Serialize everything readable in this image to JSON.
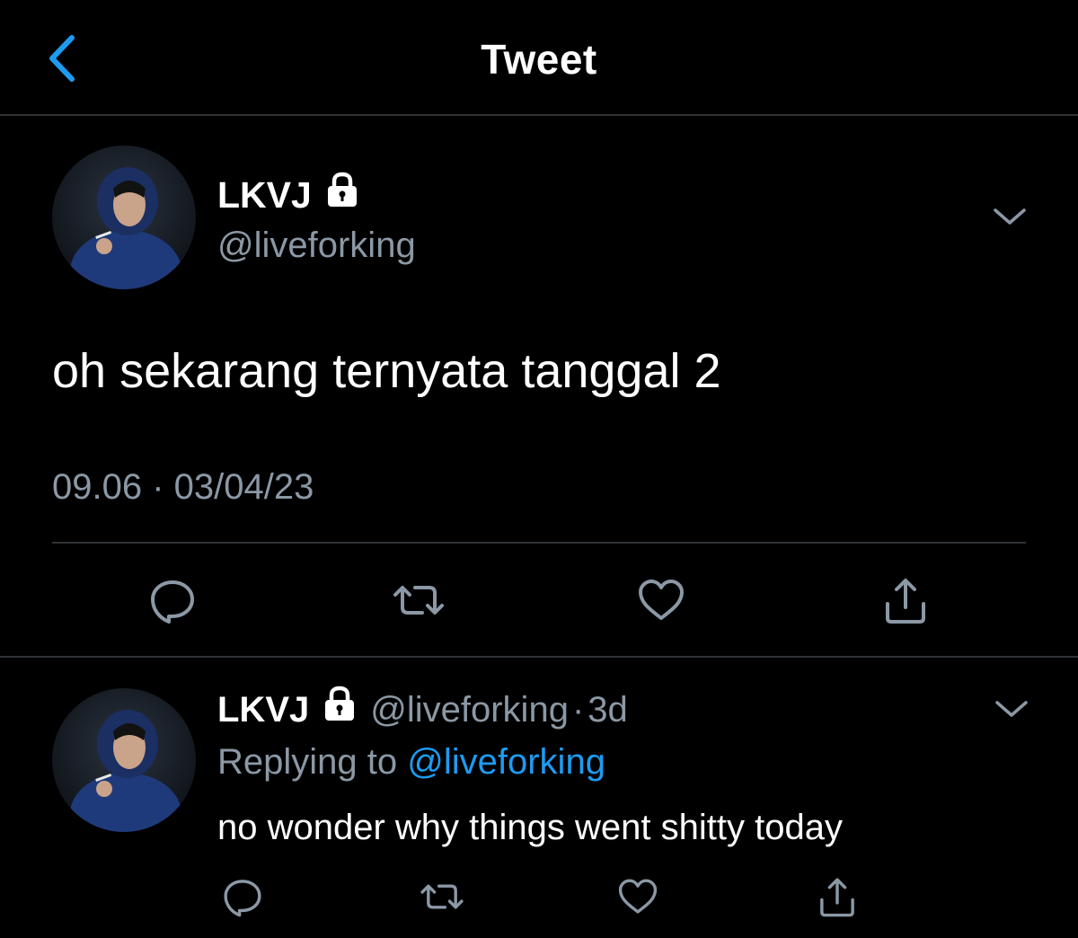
{
  "nav": {
    "title": "Tweet",
    "back_icon": "chevron-left-icon",
    "accent": "#1d9bf0"
  },
  "main_tweet": {
    "display_name": "LKVJ",
    "protected_icon": "lock-icon",
    "handle": "@liveforking",
    "text": "oh sekarang ternyata tanggal 2",
    "timestamp": "09.06 · 03/04/23",
    "menu_icon": "chevron-down-icon",
    "actions": [
      "reply-icon",
      "retweet-icon",
      "like-icon",
      "share-icon"
    ]
  },
  "reply_tweet": {
    "display_name": "LKVJ",
    "protected_icon": "lock-icon",
    "handle": "@liveforking",
    "separator": "·",
    "age": "3d",
    "replying_label": "Replying to",
    "replying_to": "@liveforking",
    "text": "no wonder why things went shitty today",
    "menu_icon": "chevron-down-icon",
    "actions": [
      "reply-icon",
      "retweet-icon",
      "like-icon",
      "share-icon"
    ]
  },
  "colors": {
    "background": "#000000",
    "primary_text": "#ffffff",
    "secondary_text": "#8b98a5",
    "link": "#1d9bf0",
    "divider": "#2f3336"
  }
}
